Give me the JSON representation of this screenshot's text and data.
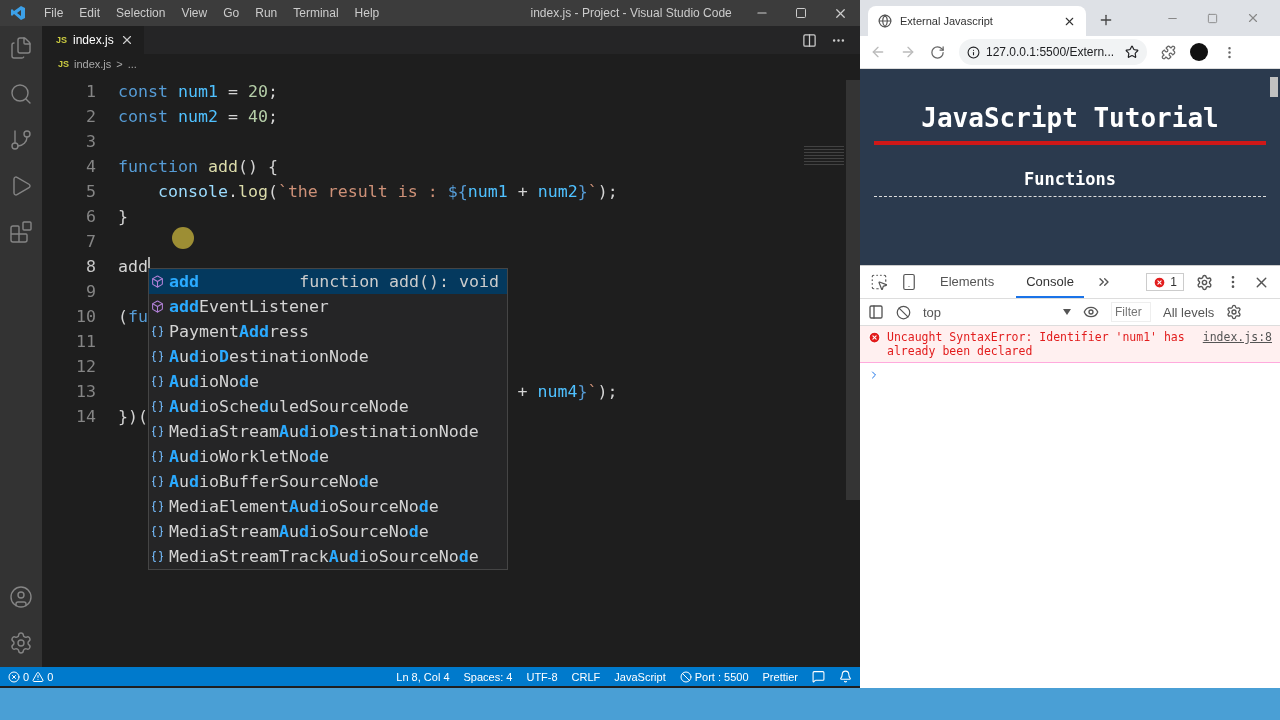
{
  "vscode": {
    "menu": [
      "File",
      "Edit",
      "Selection",
      "View",
      "Go",
      "Run",
      "Terminal",
      "Help"
    ],
    "title": "index.js - Project - Visual Studio Code",
    "tabs": [
      {
        "badge": "JS",
        "label": "index.js",
        "selected": true
      }
    ],
    "breadcrumb": {
      "badge": "JS",
      "file": "index.js",
      "separator": ">",
      "tail": "..."
    },
    "code_lines": [
      {
        "number": "1",
        "tokens": [
          {
            "text": "const ",
            "kind": "keyword"
          },
          {
            "text": "num1",
            "kind": "constant"
          },
          {
            "text": " = "
          },
          {
            "text": "20",
            "kind": "number"
          },
          {
            "text": ";"
          }
        ]
      },
      {
        "number": "2",
        "tokens": [
          {
            "text": "const ",
            "kind": "keyword"
          },
          {
            "text": "num2",
            "kind": "constant"
          },
          {
            "text": " = "
          },
          {
            "text": "40",
            "kind": "number"
          },
          {
            "text": ";"
          }
        ]
      },
      {
        "number": "3"
      },
      {
        "number": "4",
        "tokens": [
          {
            "text": "function ",
            "kind": "keyword"
          },
          {
            "text": "add",
            "kind": "function"
          },
          {
            "text": "() {"
          }
        ]
      },
      {
        "number": "5",
        "tokens": [
          {
            "text": "    console",
            "kind": "variable"
          },
          {
            "text": "."
          },
          {
            "text": "log",
            "kind": "function"
          },
          {
            "text": "("
          },
          {
            "text": "`the result is : ",
            "kind": "string"
          },
          {
            "text": "${",
            "kind": "keyword"
          },
          {
            "text": "num1",
            "kind": "constant"
          },
          {
            "text": " + "
          },
          {
            "text": "num2",
            "kind": "constant"
          },
          {
            "text": "}",
            "kind": "keyword"
          },
          {
            "text": "`",
            "kind": "string"
          },
          {
            "text": ");"
          }
        ]
      },
      {
        "number": "6",
        "tokens": [
          {
            "text": "}"
          }
        ]
      },
      {
        "number": "7"
      },
      {
        "number": "8",
        "tokens": [
          {
            "text": "add"
          }
        ],
        "cursor": true
      },
      {
        "number": "9"
      },
      {
        "number": "10",
        "tokens": [
          {
            "text": "("
          },
          {
            "text": "fu",
            "kind": "keyword"
          }
        ]
      },
      {
        "number": "11"
      },
      {
        "number": "12"
      },
      {
        "number": "13",
        "occluded": true,
        "tokens": [
          {
            "text": "+ "
          },
          {
            "text": "num4",
            "kind": "constant"
          },
          {
            "text": "}",
            "kind": "keyword"
          },
          {
            "text": "`",
            "kind": "string"
          },
          {
            "text": ");"
          }
        ]
      },
      {
        "number": "14",
        "tokens": [
          {
            "text": "})("
          }
        ]
      }
    ],
    "suggestions": [
      {
        "kind": "method",
        "selected": true,
        "detail": "function add(): void",
        "segments": [
          {
            "text": "add",
            "match": true
          }
        ]
      },
      {
        "kind": "method",
        "selected": false,
        "segments": [
          {
            "text": "add",
            "match": true
          },
          {
            "text": "EventListener",
            "match": false
          }
        ]
      },
      {
        "kind": "variable",
        "selected": false,
        "segments": [
          {
            "text": "Payment",
            "match": false
          },
          {
            "text": "Add",
            "match": true
          },
          {
            "text": "ress",
            "match": false
          }
        ]
      },
      {
        "kind": "variable",
        "selected": false,
        "segments": [
          {
            "text": "A",
            "match": true
          },
          {
            "text": "u",
            "match": false
          },
          {
            "text": "d",
            "match": true
          },
          {
            "text": "io",
            "match": false
          },
          {
            "text": "D",
            "match": true
          },
          {
            "text": "estinationNode",
            "match": false
          }
        ]
      },
      {
        "kind": "variable",
        "selected": false,
        "segments": [
          {
            "text": "A",
            "match": true
          },
          {
            "text": "u",
            "match": false
          },
          {
            "text": "d",
            "match": true
          },
          {
            "text": "ioNo",
            "match": false
          },
          {
            "text": "d",
            "match": true
          },
          {
            "text": "e",
            "match": false
          }
        ]
      },
      {
        "kind": "variable",
        "selected": false,
        "segments": [
          {
            "text": "A",
            "match": true
          },
          {
            "text": "u",
            "match": false
          },
          {
            "text": "d",
            "match": true
          },
          {
            "text": "ioSche",
            "match": false
          },
          {
            "text": "d",
            "match": true
          },
          {
            "text": "uledSourceNode",
            "match": false
          }
        ]
      },
      {
        "kind": "variable",
        "selected": false,
        "segments": [
          {
            "text": "MediaStream",
            "match": false
          },
          {
            "text": "A",
            "match": true
          },
          {
            "text": "u",
            "match": false
          },
          {
            "text": "d",
            "match": true
          },
          {
            "text": "io",
            "match": false
          },
          {
            "text": "D",
            "match": true
          },
          {
            "text": "estinationNode",
            "match": false
          }
        ]
      },
      {
        "kind": "variable",
        "selected": false,
        "segments": [
          {
            "text": "A",
            "match": true
          },
          {
            "text": "u",
            "match": false
          },
          {
            "text": "d",
            "match": true
          },
          {
            "text": "ioWorkletNo",
            "match": false
          },
          {
            "text": "d",
            "match": true
          },
          {
            "text": "e",
            "match": false
          }
        ]
      },
      {
        "kind": "variable",
        "selected": false,
        "segments": [
          {
            "text": "A",
            "match": true
          },
          {
            "text": "u",
            "match": false
          },
          {
            "text": "d",
            "match": true
          },
          {
            "text": "ioBufferSourceNo",
            "match": false
          },
          {
            "text": "d",
            "match": true
          },
          {
            "text": "e",
            "match": false
          }
        ]
      },
      {
        "kind": "variable",
        "selected": false,
        "segments": [
          {
            "text": "MediaElement",
            "match": false
          },
          {
            "text": "A",
            "match": true
          },
          {
            "text": "u",
            "match": false
          },
          {
            "text": "d",
            "match": true
          },
          {
            "text": "ioSourceNo",
            "match": false
          },
          {
            "text": "d",
            "match": true
          },
          {
            "text": "e",
            "match": false
          }
        ]
      },
      {
        "kind": "variable",
        "selected": false,
        "segments": [
          {
            "text": "MediaStream",
            "match": false
          },
          {
            "text": "A",
            "match": true
          },
          {
            "text": "u",
            "match": false
          },
          {
            "text": "d",
            "match": true
          },
          {
            "text": "ioSourceNo",
            "match": false
          },
          {
            "text": "d",
            "match": true
          },
          {
            "text": "e",
            "match": false
          }
        ]
      },
      {
        "kind": "variable",
        "selected": false,
        "segments": [
          {
            "text": "MediaStreamTrack",
            "match": false
          },
          {
            "text": "A",
            "match": true
          },
          {
            "text": "u",
            "match": false
          },
          {
            "text": "d",
            "match": true
          },
          {
            "text": "ioSourceNo",
            "match": false
          },
          {
            "text": "d",
            "match": true
          },
          {
            "text": "e",
            "match": false
          }
        ]
      }
    ],
    "status_bar": {
      "errors": "0",
      "warnings": "0",
      "items": [
        {
          "kind": "text",
          "text": "Ln 8, Col 4"
        },
        {
          "kind": "text",
          "text": "Spaces: 4"
        },
        {
          "kind": "text",
          "text": "UTF-8"
        },
        {
          "kind": "text",
          "text": "CRLF"
        },
        {
          "kind": "text",
          "text": "JavaScript"
        },
        {
          "kind": "port",
          "text": "Port : 5500"
        },
        {
          "kind": "text",
          "text": "Prettier"
        }
      ]
    }
  },
  "browser": {
    "tab_title": "External Javascript",
    "url": "127.0.0.1:5500/Extern...",
    "page": {
      "title": "JavaScript Tutorial",
      "subtitle": "Functions"
    },
    "devtools": {
      "tabs": [
        {
          "label": "Elements",
          "selected": false
        },
        {
          "label": "Console",
          "selected": true
        }
      ],
      "error_count": "1",
      "context": "top",
      "filter_placeholder": "Filter",
      "levels": "All levels",
      "messages": [
        {
          "kind": "error",
          "text": "Uncaught SyntaxError: Identifier 'num1' has already been declared",
          "source": "index.js:8"
        }
      ]
    }
  }
}
